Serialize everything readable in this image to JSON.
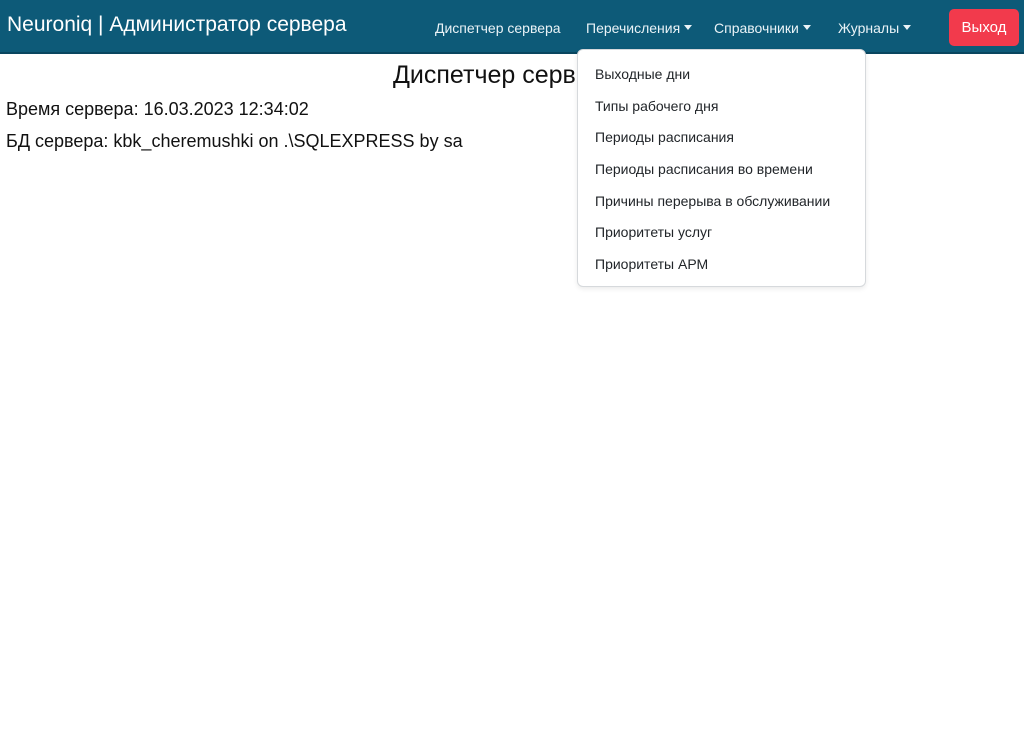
{
  "navbar": {
    "brand": "Neuroniq | Администратор сервера",
    "items": [
      {
        "label": "Диспетчер сервера"
      },
      {
        "label": "Перечисления"
      },
      {
        "label": "Справочники"
      },
      {
        "label": "Журналы"
      }
    ],
    "logout_label": "Выход",
    "background_color": "#0d5a78",
    "logout_color": "#f23a4c"
  },
  "page": {
    "title": "Диспетчер серв",
    "server_time": "Время сервера: 16.03.2023 12:34:02",
    "server_db": "БД сервера: kbk_cheremushki on .\\SQLEXPRESS by sa"
  },
  "dropdown": {
    "items": [
      {
        "label": "Выходные дни"
      },
      {
        "label": "Типы рабочего дня"
      },
      {
        "label": "Периоды расписания"
      },
      {
        "label": "Периоды расписания во времени"
      },
      {
        "label": "Причины перерыва в обслуживании"
      },
      {
        "label": "Приоритеты услуг"
      },
      {
        "label": "Приоритеты АРМ"
      }
    ]
  }
}
